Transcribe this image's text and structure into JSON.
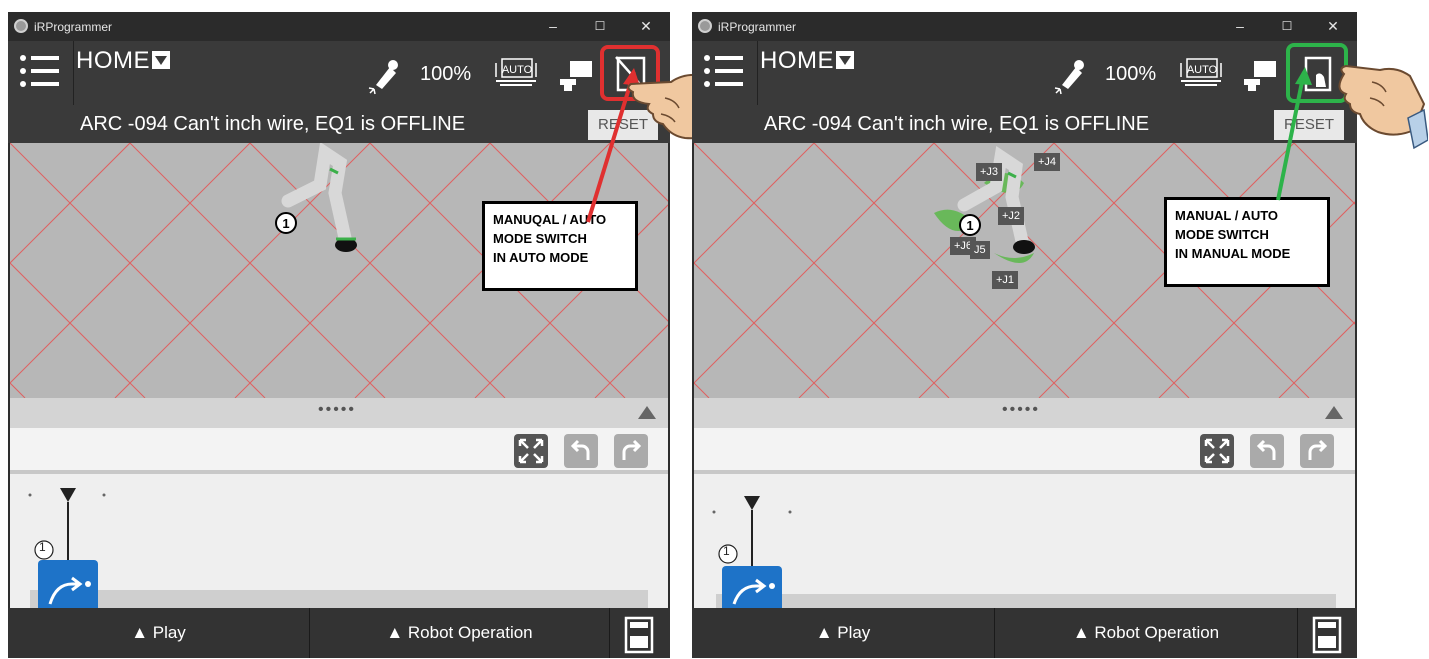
{
  "app_title": "iRProgrammer",
  "window_controls": {
    "minimize": "–",
    "maximize": "☐",
    "close": "✕"
  },
  "toolbar": {
    "home_label": "HOME",
    "speed": "100%",
    "auto_label": "AUTO"
  },
  "alarm": {
    "message": "ARC   -094 Can't inch wire, EQ1 is OFFLINE",
    "reset_label": "RESET"
  },
  "program": {
    "node_number": "1"
  },
  "bottom_bar": {
    "play_label": "▲ Play",
    "robot_operation_label": "▲ Robot Operation"
  },
  "left_panel": {
    "callout": [
      "MANUQAL / AUTO",
      "MODE SWITCH",
      "IN AUTO MODE"
    ],
    "mode_state": "auto",
    "highlight_color": "#e03030"
  },
  "right_panel": {
    "callout": [
      "MANUAL / AUTO",
      "MODE SWITCH",
      "IN MANUAL MODE"
    ],
    "mode_state": "manual",
    "highlight_color": "#2db34a",
    "joint_labels": [
      "+J4",
      "+J3",
      "+J2",
      "+J6",
      "J5",
      "+J1"
    ]
  }
}
